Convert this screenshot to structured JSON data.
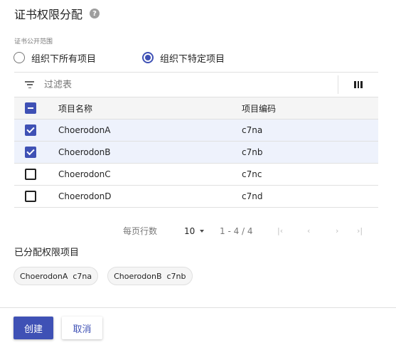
{
  "header": {
    "title": "证书权限分配",
    "help_icon": "help-circle-icon"
  },
  "scope": {
    "label": "证书公开范围",
    "options": [
      {
        "label": "组织下所有项目",
        "checked": false
      },
      {
        "label": "组织下特定项目",
        "checked": true
      }
    ]
  },
  "table": {
    "filter_placeholder": "过滤表",
    "filter_icon": "filter-list-icon",
    "columns_icon": "view-column-icon",
    "headers": {
      "name": "项目名称",
      "code": "项目编码"
    },
    "rows": [
      {
        "name": "ChoerodonA",
        "code": "c7na",
        "checked": true
      },
      {
        "name": "ChoerodonB",
        "code": "c7nb",
        "checked": true
      },
      {
        "name": "ChoerodonC",
        "code": "c7nc",
        "checked": false
      },
      {
        "name": "ChoerodonD",
        "code": "c7nd",
        "checked": false
      }
    ]
  },
  "pagination": {
    "rows_per_page_label": "每页行数",
    "page_size": "10",
    "range": "1 - 4 / 4"
  },
  "assigned": {
    "title": "已分配权限项目",
    "chips": [
      "ChoerodonA  c7na",
      "ChoerodonB  c7nb"
    ]
  },
  "footer": {
    "create_label": "创建",
    "cancel_label": "取消"
  },
  "colors": {
    "primary": "#3f51b5",
    "selected_row": "#eef2fc"
  }
}
